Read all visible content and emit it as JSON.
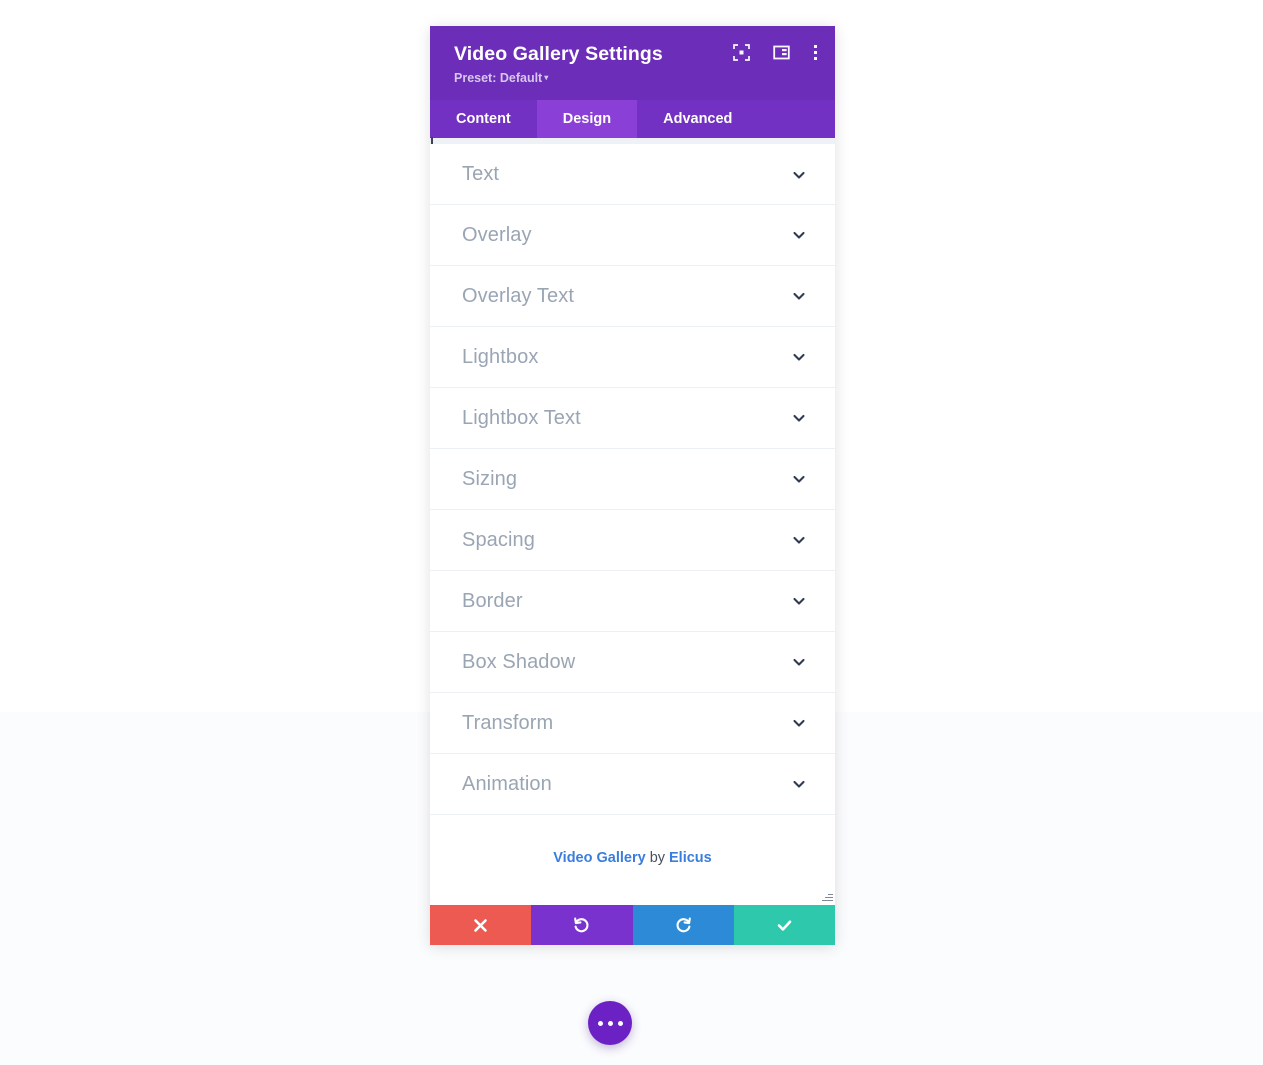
{
  "modal": {
    "title": "Video Gallery Settings",
    "preset_label": "Preset: Default",
    "preset_caret": "▾",
    "header_icons": [
      {
        "name": "focus-icon",
        "title": "Focus"
      },
      {
        "name": "panel-layout-icon",
        "title": "Layout"
      },
      {
        "name": "kebab-menu-icon",
        "title": "More options"
      }
    ],
    "tabs": [
      {
        "label": "Content",
        "active": false
      },
      {
        "label": "Design",
        "active": true
      },
      {
        "label": "Advanced",
        "active": false
      }
    ],
    "sections": [
      {
        "label": "Text"
      },
      {
        "label": "Overlay"
      },
      {
        "label": "Overlay Text"
      },
      {
        "label": "Lightbox"
      },
      {
        "label": "Lightbox Text"
      },
      {
        "label": "Sizing"
      },
      {
        "label": "Spacing"
      },
      {
        "label": "Border"
      },
      {
        "label": "Box Shadow"
      },
      {
        "label": "Transform"
      },
      {
        "label": "Animation"
      }
    ],
    "credit": {
      "product": "Video Gallery",
      "by": "by",
      "author": "Elicus"
    },
    "footer_buttons": [
      {
        "name": "cancel-button",
        "icon": "close-x-icon",
        "color": "#ec5a52"
      },
      {
        "name": "undo-button",
        "icon": "undo-arrow-icon",
        "color": "#7a32cf"
      },
      {
        "name": "redo-button",
        "icon": "redo-arrow-icon",
        "color": "#2c8ad6"
      },
      {
        "name": "save-button",
        "icon": "check-icon",
        "color": "#2ec9ad"
      }
    ]
  },
  "fab": {
    "name": "more-options-fab",
    "icon": "three-dots-icon",
    "color": "#6b21c4"
  },
  "colors": {
    "header_purple": "#6c2eb9",
    "tabbar_purple": "#7231c2",
    "tab_active_purple": "#8a3fd6",
    "label_gray": "#9aa5b4",
    "link_blue": "#3b7ddd"
  }
}
